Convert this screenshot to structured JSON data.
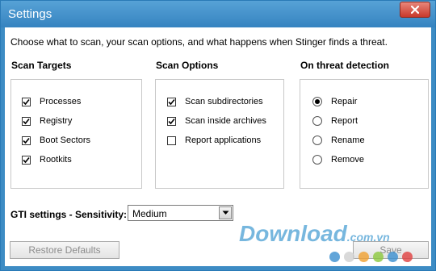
{
  "window": {
    "title": "Settings"
  },
  "description": "Choose what to scan, your scan options, and what happens when Stinger finds a threat.",
  "scan_targets": {
    "heading": "Scan Targets",
    "items": [
      {
        "label": "Processes",
        "checked": true
      },
      {
        "label": "Registry",
        "checked": true
      },
      {
        "label": "Boot Sectors",
        "checked": true
      },
      {
        "label": "Rootkits",
        "checked": true
      }
    ]
  },
  "scan_options": {
    "heading": "Scan Options",
    "items": [
      {
        "label": "Scan subdirectories",
        "checked": true
      },
      {
        "label": "Scan inside archives",
        "checked": true
      },
      {
        "label": "Report applications",
        "checked": false
      }
    ]
  },
  "threat_detection": {
    "heading": "On threat detection",
    "options": [
      {
        "label": "Repair",
        "selected": true
      },
      {
        "label": "Report",
        "selected": false
      },
      {
        "label": "Rename",
        "selected": false
      },
      {
        "label": "Remove",
        "selected": false
      }
    ]
  },
  "gti": {
    "label": "GTI settings - Sensitivity:",
    "selected_value": "Medium"
  },
  "buttons": {
    "restore_defaults": "Restore Defaults",
    "save": "Save"
  },
  "watermark": {
    "text": "Download",
    "suffix": ".com.vn",
    "dot_colors": [
      "#3a8fd0",
      "#d0d0d0",
      "#f0a030",
      "#8cc83c",
      "#3a8fd0",
      "#e04040"
    ]
  },
  "colors": {
    "title_bar": "#3d8cc4",
    "close_button": "#c8392b",
    "watermark": "#4a9fd4"
  }
}
